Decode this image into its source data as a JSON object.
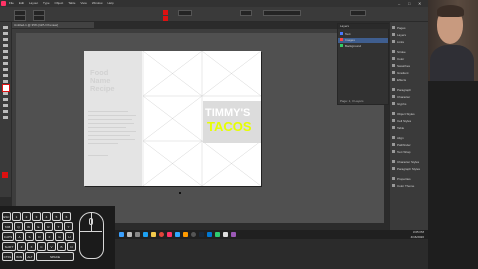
{
  "window": {
    "menus": [
      "File",
      "Edit",
      "Layout",
      "Type",
      "Object",
      "Table",
      "View",
      "Window",
      "Help"
    ],
    "doc_tab": "Untitled-1 @ 35%  [GPU Preview]"
  },
  "document": {
    "placeholder_title": [
      "Food",
      "Name",
      "Recipe"
    ],
    "brand_line1": "TIMMY'S",
    "brand_line2": "TACOS",
    "brand_color": "#e6ff00"
  },
  "layers_panel": {
    "tabs": [
      "Layers"
    ],
    "rows": [
      {
        "name": "Text",
        "color": "#4a78ff"
      },
      {
        "name": "Images",
        "color": "#ff4444"
      },
      {
        "name": "Background",
        "color": "#33cc66"
      }
    ],
    "footer": "Page: 1, 3 Layers"
  },
  "side_panel": {
    "items": [
      "Pages",
      "Layers",
      "Links",
      "Stroke",
      "Color",
      "Swatches",
      "Gradient",
      "Effects",
      "Paragraph",
      "Character",
      "Glyphs",
      "Object Styles",
      "Cell Styles",
      "Table",
      "Align",
      "Pathfinder",
      "Text Wrap",
      "Character Styles",
      "Paragraph Styles",
      "Properties",
      "Color Theme"
    ]
  },
  "taskbar": {
    "time": "3:05 PM",
    "date": "4/16/2020"
  },
  "overlay": {
    "keys_row1": [
      "ESC",
      "1",
      "2",
      "3",
      "4",
      "5",
      "6"
    ],
    "keys_row2": [
      "TAB",
      "Q",
      "W",
      "E",
      "R",
      "T",
      "Y"
    ],
    "keys_row3": [
      "CAPS",
      "A",
      "S",
      "D",
      "F",
      "G",
      "H"
    ],
    "keys_row4": [
      "SHIFT",
      "Z",
      "X",
      "C",
      "V",
      "B",
      "N"
    ],
    "keys_row5": [
      "CTRL",
      "WIN",
      "ALT",
      "SPACE"
    ]
  },
  "icons": {
    "taskbar": [
      "windows-icon",
      "search-icon",
      "task-view-icon",
      "edge-icon",
      "explorer-icon",
      "chrome-icon",
      "indesign-icon",
      "photoshop-icon",
      "illustrator-icon",
      "obs-icon",
      "steam-icon",
      "mail-icon"
    ]
  }
}
